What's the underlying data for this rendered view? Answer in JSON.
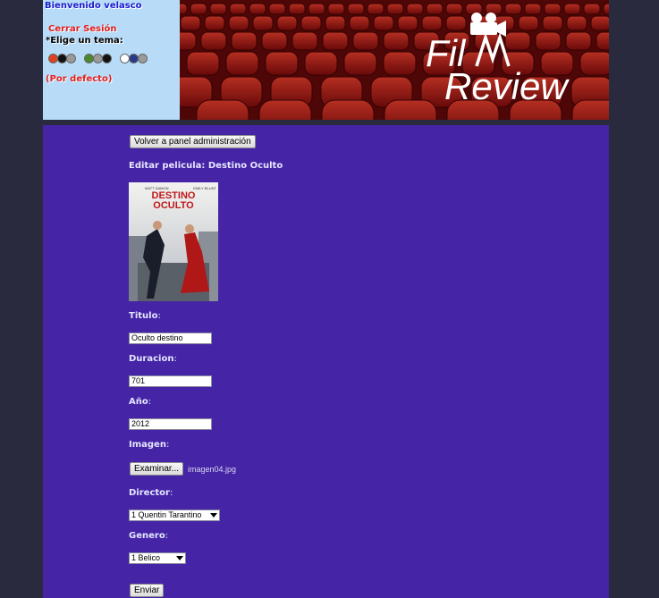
{
  "sidebar": {
    "welcome": "Bienvenido velasco",
    "logout": "Cerrar Sesión",
    "theme_label": "*Elige un tema:",
    "default_theme": "(Por defecto)",
    "themes": [
      {
        "colors": [
          "#e04020",
          "#111111",
          "#9a9a9a"
        ]
      },
      {
        "colors": [
          "#4a8a2a",
          "#9a9a9a",
          "#111111"
        ]
      },
      {
        "colors": [
          "#ffffff",
          "#2a3a8a",
          "#9a9a9a"
        ]
      }
    ]
  },
  "banner": {
    "logo_line1": "Fil",
    "logo_line2": "Review"
  },
  "form": {
    "back_button": "Volver a panel administración",
    "heading": "Editar pelicula: Destino Oculto",
    "poster_title": "DESTINO\nOCULTO",
    "poster_actors": [
      "MATT DAMON",
      "EMILY BLUNT"
    ],
    "titulo_label": "Titulo",
    "titulo_value": "Oculto destino",
    "duracion_label": "Duracion",
    "duracion_value": "701",
    "anio_label": "Año",
    "anio_value": "2012",
    "imagen_label": "Imagen",
    "browse_button": "Examinar...",
    "file_name": "imagen04.jpg",
    "director_label": "Director",
    "director_value": "1 Quentin Tarantino",
    "genero_label": "Genero",
    "genero_value": "1 Belico",
    "submit_button": "Enviar"
  },
  "colors": {
    "content_bg": "#4524a6",
    "sidebar_bg": "#b8dcf8",
    "page_bg": "#2a2a3e"
  }
}
